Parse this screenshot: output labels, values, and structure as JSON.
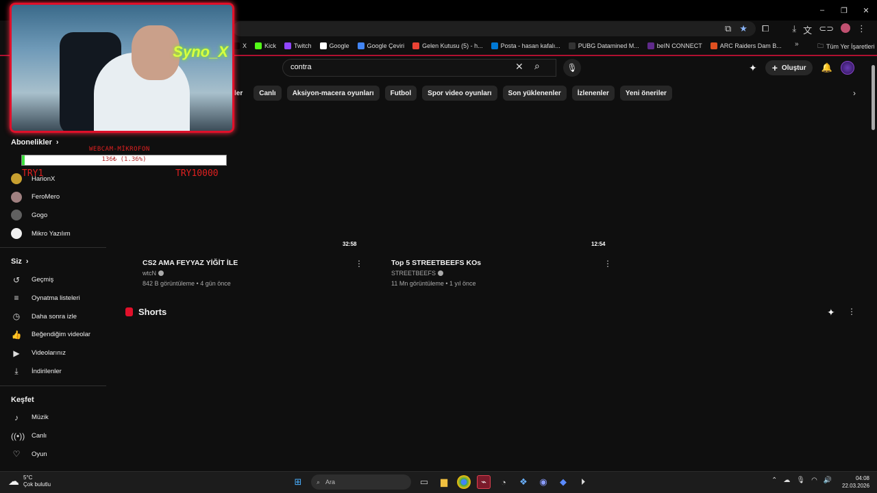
{
  "browser": {
    "window_controls": [
      "–",
      "❐",
      "✕"
    ],
    "bookmarks": [
      {
        "label": "X",
        "color": "#000000"
      },
      {
        "label": "Kick",
        "color": "#53fc18"
      },
      {
        "label": "Twitch",
        "color": "#9146ff"
      },
      {
        "label": "Google",
        "color": "#ffffff"
      },
      {
        "label": "Google Çeviri",
        "color": "#4285f4"
      },
      {
        "label": "Gelen Kutusu (5) - h...",
        "color": "#ea4335"
      },
      {
        "label": "Posta - hasan kafalı...",
        "color": "#0078d4"
      },
      {
        "label": "PUBG Datamined M...",
        "color": "#333333"
      },
      {
        "label": "beIN CONNECT",
        "color": "#5f2a8a"
      },
      {
        "label": "ARC Raiders Dam B...",
        "color": "#e05020"
      }
    ],
    "bookmarks_more": "»",
    "all_bookmarks": "Tüm Yer İşaretleri"
  },
  "header": {
    "search_value": "contra",
    "create_label": "Oluştur"
  },
  "chips": [
    "ler",
    "Canlı",
    "Aksiyon-macera oyunları",
    "Futbol",
    "Spor video oyunları",
    "Son yüklenenler",
    "İzlenenler",
    "Yeni öneriler"
  ],
  "sidebar": {
    "subscriptions_title": "Abonelikler",
    "subscriptions": [
      {
        "label": "HarionX",
        "color": "#c8a030"
      },
      {
        "label": "FeroMero",
        "color": "#a08080"
      },
      {
        "label": "Gogo",
        "color": "#606060"
      },
      {
        "label": "Mikro Yazılım",
        "color": "#f0f0f0"
      }
    ],
    "you_title": "Siz",
    "you_items": [
      {
        "label": "Geçmiş",
        "icon": "history-icon",
        "glyph": "↺"
      },
      {
        "label": "Oynatma listeleri",
        "icon": "playlist-icon",
        "glyph": "≡"
      },
      {
        "label": "Daha sonra izle",
        "icon": "clock-icon",
        "glyph": "◷"
      },
      {
        "label": "Beğendiğim videolar",
        "icon": "thumbs-up-icon",
        "glyph": "👍"
      },
      {
        "label": "Videolarınız",
        "icon": "video-icon",
        "glyph": "▶"
      },
      {
        "label": "İndirilenler",
        "icon": "download-icon",
        "glyph": "⤓"
      }
    ],
    "explore_title": "Keşfet",
    "explore_items": [
      {
        "label": "Müzik",
        "icon": "music-icon",
        "glyph": "♪"
      },
      {
        "label": "Canlı",
        "icon": "live-icon",
        "glyph": "((•))"
      },
      {
        "label": "Oyun",
        "icon": "gaming-icon",
        "glyph": "♡"
      }
    ]
  },
  "overlay": {
    "neon_text": "Syno_X",
    "label": "WEBCAM-MİKROFON",
    "progress_text": "136₺ (1.36%)",
    "progress_fraction": 0.0136,
    "min_text": "TRY1",
    "max_text": "TRY10000"
  },
  "videos": [
    {
      "duration": "32:58",
      "title": "CS2 AMA FEYYAZ YİĞİT İLE",
      "channel": "wtcN",
      "meta": "842 B görüntüleme • 4 gün önce"
    },
    {
      "duration": "12:54",
      "title": "Top 5 STREETBEEFS KOs",
      "channel": "STREETBEEFS",
      "meta": "11 Mn görüntüleme • 1 yıl önce"
    }
  ],
  "shorts": {
    "title": "Shorts"
  },
  "taskbar": {
    "weather_temp": "5°C",
    "weather_desc": "Çok bulutlu",
    "search_placeholder": "Ara",
    "time": "04:08",
    "date": "22.03.2026"
  }
}
